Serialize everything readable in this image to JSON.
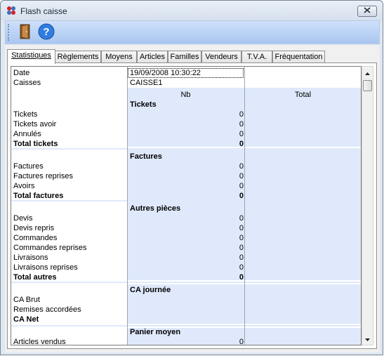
{
  "window": {
    "title": "Flash caisse"
  },
  "toolbar": {
    "buttons": [
      {
        "icon": "exit-door-icon"
      },
      {
        "icon": "help-icon",
        "glyph": "?"
      }
    ]
  },
  "tabs": [
    "Statistiques",
    "Règlements",
    "Moyens",
    "Articles",
    "Familles",
    "Vendeurs",
    "T.V.A.",
    "Fréquentation"
  ],
  "active_tab": "Statistiques",
  "grid": {
    "date_label": "Date",
    "date_value": "19/09/2008 10:30:22",
    "caisses_label": "Caisses",
    "caisses_value": "CAISSE1",
    "col_nb": "Nb",
    "col_total": "Total",
    "tickets": {
      "header": "Tickets",
      "rows": [
        {
          "label": "Tickets",
          "nb": "0"
        },
        {
          "label": "Tickets avoir",
          "nb": "0"
        },
        {
          "label": "Annulés",
          "nb": "0"
        }
      ],
      "total_label": "Total tickets",
      "total_nb": "0"
    },
    "factures": {
      "header": "Factures",
      "rows": [
        {
          "label": "Factures",
          "nb": "0"
        },
        {
          "label": "Factures reprises",
          "nb": "0"
        },
        {
          "label": "Avoirs",
          "nb": "0"
        }
      ],
      "total_label": "Total factures",
      "total_nb": "0"
    },
    "autres": {
      "header": "Autres pièces",
      "rows": [
        {
          "label": "Devis",
          "nb": "0"
        },
        {
          "label": "Devis repris",
          "nb": "0"
        },
        {
          "label": "Commandes",
          "nb": "0"
        },
        {
          "label": "Commandes reprises",
          "nb": "0"
        },
        {
          "label": "Livraisons",
          "nb": "0"
        },
        {
          "label": "Livraisons reprises",
          "nb": "0"
        }
      ],
      "total_label": "Total autres",
      "total_nb": "0"
    },
    "ca": {
      "header": "CA journée",
      "rows": [
        {
          "label": "CA Brut"
        },
        {
          "label": "Remises accordées"
        }
      ],
      "total_label": "CA Net"
    },
    "panier": {
      "header": "Panier moyen",
      "rows": [
        {
          "label": "Articles vendus",
          "nb": "0"
        }
      ]
    }
  },
  "colors": {
    "row_shade": "#dfe9fb",
    "toolbar": "#b9d1f5"
  }
}
